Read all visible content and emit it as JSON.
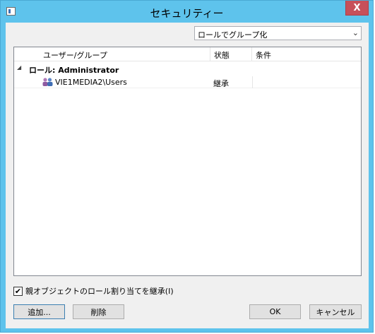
{
  "window": {
    "title": "セキュリティー",
    "close_symbol": "X"
  },
  "group_by": {
    "selected": "ロールでグループ化",
    "dropdown_symbol": "⌄"
  },
  "list": {
    "columns": [
      "ユーザー/グループ",
      "状態",
      "条件"
    ],
    "group": {
      "expander": "◢",
      "label": "ロール: Administrator"
    },
    "rows": [
      {
        "name": "VIE1MEDIA2\\Users",
        "status": "継承",
        "condition": ""
      }
    ]
  },
  "inherit": {
    "checked": true,
    "check_symbol": "✔",
    "label": "親オブジェクトのロール割り当てを継承(I)"
  },
  "buttons": {
    "add": "追加...",
    "delete": "削除",
    "ok": "OK",
    "cancel": "キャンセル"
  },
  "colors": {
    "titlebar": "#5ec3ec",
    "close": "#c7505a",
    "dialog_bg": "#f0f0f0"
  }
}
